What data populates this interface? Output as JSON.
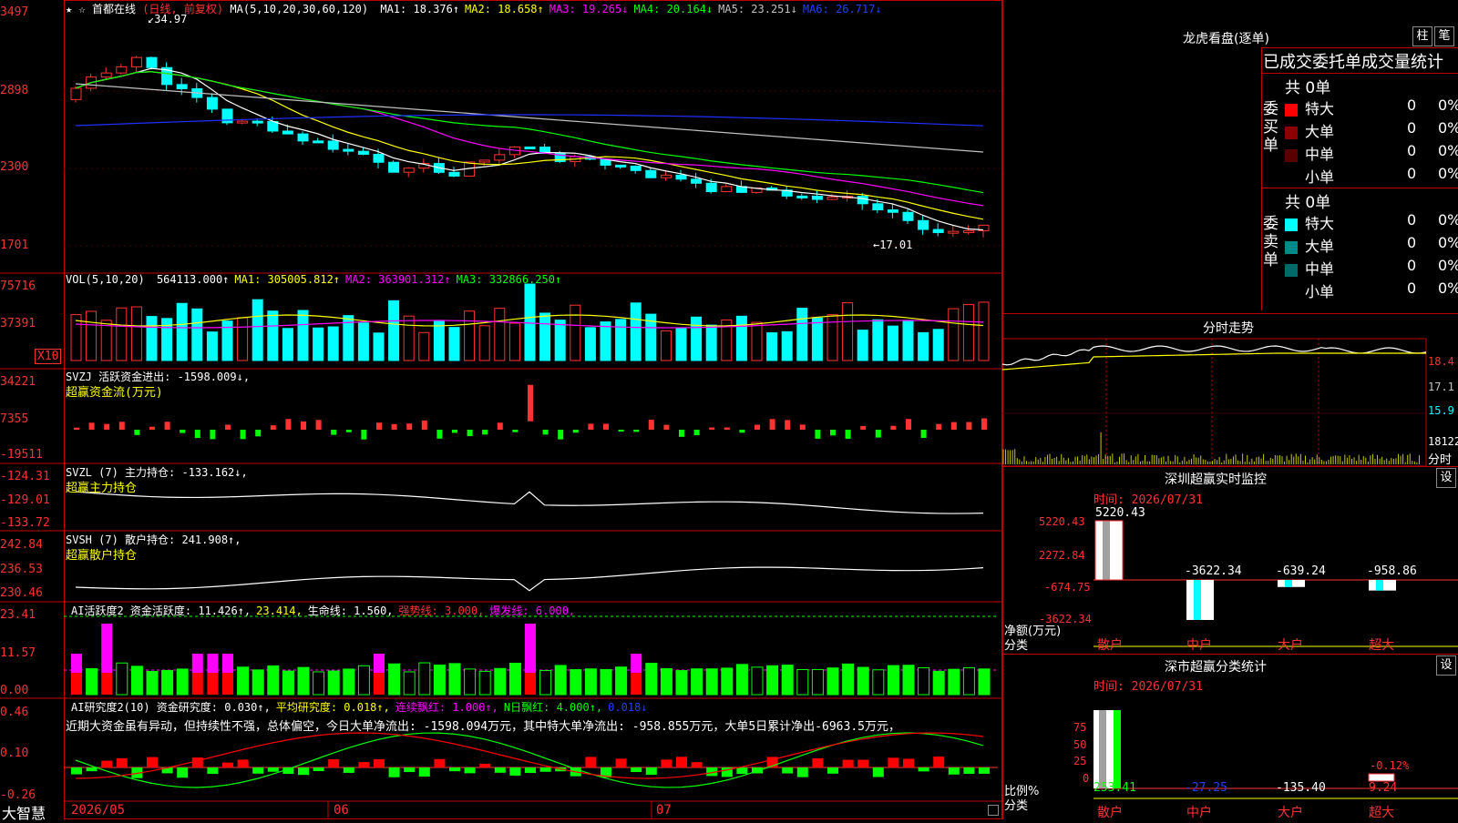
{
  "stock": {
    "name": "首都在线",
    "period": "日线",
    "adjust": "前复权",
    "header_rest": "MA(5,10,20,30,60,120)",
    "ma": [
      {
        "label": "MA1: 18.376↑",
        "color": "#ffffff"
      },
      {
        "label": "MA2: 18.658↑",
        "color": "#ffff00"
      },
      {
        "label": "MA3: 19.265↓",
        "color": "#ff00ff"
      },
      {
        "label": "MA4: 20.164↓",
        "color": "#00ff00"
      },
      {
        "label": "MA5: 23.251↓",
        "color": "#c0c0c0"
      },
      {
        "label": "MA6: 26.717↓",
        "color": "#2040ff"
      }
    ],
    "high_mark": "34.97",
    "low_mark": "←17.01",
    "yaxis": [
      "3497",
      "2898",
      "2300",
      "1701"
    ]
  },
  "vol": {
    "header": "VOL(5,10,20)",
    "values": [
      {
        "label": "564113.000↑",
        "color": "#ffffff"
      },
      {
        "label": "MA1: 305005.812↑",
        "color": "#ffff00"
      },
      {
        "label": "MA2: 363901.312↑",
        "color": "#ff00ff"
      },
      {
        "label": "MA3: 332866.250↑",
        "color": "#00ff00"
      }
    ],
    "yaxis": [
      "75716",
      "37391"
    ],
    "unit": "X10"
  },
  "svzj": {
    "header": "SVZJ  活跃资金进出: -1598.009↓,",
    "sub": "超赢资金流(万元)",
    "yaxis": [
      "34221",
      "7355",
      "-19511"
    ]
  },
  "svzl": {
    "header": "SVZL (7) 主力持仓: -133.162↓,",
    "sub": "超赢主力持仓",
    "yaxis": [
      "-124.31",
      "-129.01",
      "-133.72"
    ]
  },
  "svsh": {
    "header": "SVSH (7) 散户持仓: 241.908↑,",
    "sub": "超赢散户持仓",
    "yaxis": [
      "242.84",
      "236.53",
      "230.46"
    ]
  },
  "ai1": {
    "items": [
      {
        "label": "AI活跃度2 资金活跃度: 11.426↑,",
        "color": "#ffffff"
      },
      {
        "label": "23.414,",
        "color": "#ffff00"
      },
      {
        "label": "生命线: 1.560,",
        "color": "#ffffff"
      },
      {
        "label": "强势线: 3.000,",
        "color": "#ff3232"
      },
      {
        "label": "爆发线: 6.000,",
        "color": "#ff00ff"
      }
    ],
    "yaxis": [
      "23.41",
      "11.57",
      "0.00"
    ]
  },
  "ai2": {
    "items": [
      {
        "label": "AI研究度2(10) 资金研究度: 0.030↑,",
        "color": "#ffffff"
      },
      {
        "label": "平均研究度: 0.018↑,",
        "color": "#ffff00"
      },
      {
        "label": "连续飘红: 1.000↑,",
        "color": "#ff00ff"
      },
      {
        "label": "N日飘红: 4.000↑,",
        "color": "#00ff00"
      },
      {
        "label": "0.018↓",
        "color": "#2040ff"
      }
    ],
    "comment": "近期大资金虽有异动，但持续性不强，总体偏空，今日大单净流出: -1598.094万元，其中特大单净流出: -958.855万元，大单5日累计净出-6963.5万元，",
    "yaxis": [
      "0.46",
      "0.10",
      "-0.26"
    ]
  },
  "xaxis": {
    "app": "大智慧",
    "labels": [
      "2026/05",
      "06",
      "07"
    ]
  },
  "right": {
    "title": "龙虎看盘(逐单)",
    "btn1": "柱",
    "btn2": "笔",
    "order_title": "已成交委托单成交量统计",
    "buy_label": "委买单",
    "sell_label": "委卖单",
    "buy_total": "共 0单",
    "sell_total": "共 0单",
    "buy_rows": [
      {
        "name": "特大",
        "val": "0",
        "pct": "0%",
        "color": "#ff0000"
      },
      {
        "name": "大单",
        "val": "0",
        "pct": "0%",
        "color": "#8b0000"
      },
      {
        "name": "中单",
        "val": "0",
        "pct": "0%",
        "color": "#5a0000"
      },
      {
        "name": "小单",
        "val": "0",
        "pct": "0%",
        "color": "#000000"
      }
    ],
    "sell_rows": [
      {
        "name": "特大",
        "val": "0",
        "pct": "0%",
        "color": "#00ffff"
      },
      {
        "name": "大单",
        "val": "0",
        "pct": "0%",
        "color": "#008b8b"
      },
      {
        "name": "中单",
        "val": "0",
        "pct": "0%",
        "color": "#006a6a"
      },
      {
        "name": "小单",
        "val": "0",
        "pct": "0%",
        "color": "#000000"
      }
    ],
    "intraday": {
      "title": "分时走势",
      "yaxis": [
        "18.4",
        "17.1",
        "15.9",
        "18122"
      ],
      "xlab": "分时"
    },
    "monitor": {
      "title": "深圳超赢实时监控",
      "btn": "设",
      "time": "时间: 2026/07/31",
      "yaxis": [
        "5220.43",
        "2272.84",
        "-674.75",
        "-3622.34"
      ],
      "ylabel": "净额(万元)",
      "xlabel": "分类",
      "bar_labels": [
        "5220.43",
        "-3622.34",
        "-639.24",
        "-958.86"
      ],
      "bar_values": [
        5220.43,
        -3622.34,
        -639.24,
        -958.86
      ],
      "cats": [
        "散户",
        "中户",
        "大户",
        "超大"
      ]
    },
    "classify": {
      "title": "深市超赢分类统计",
      "btn": "设",
      "time": "时间: 2026/07/31",
      "yaxis": [
        "75",
        "50",
        "25",
        "0"
      ],
      "ylabel": "比例%",
      "xlabel": "分类",
      "extra": "-0.12%",
      "vals": [
        "253.41",
        "-27.25",
        "-135.40",
        "9.24"
      ],
      "cats": [
        "散户",
        "中户",
        "大户",
        "超大"
      ]
    }
  }
}
